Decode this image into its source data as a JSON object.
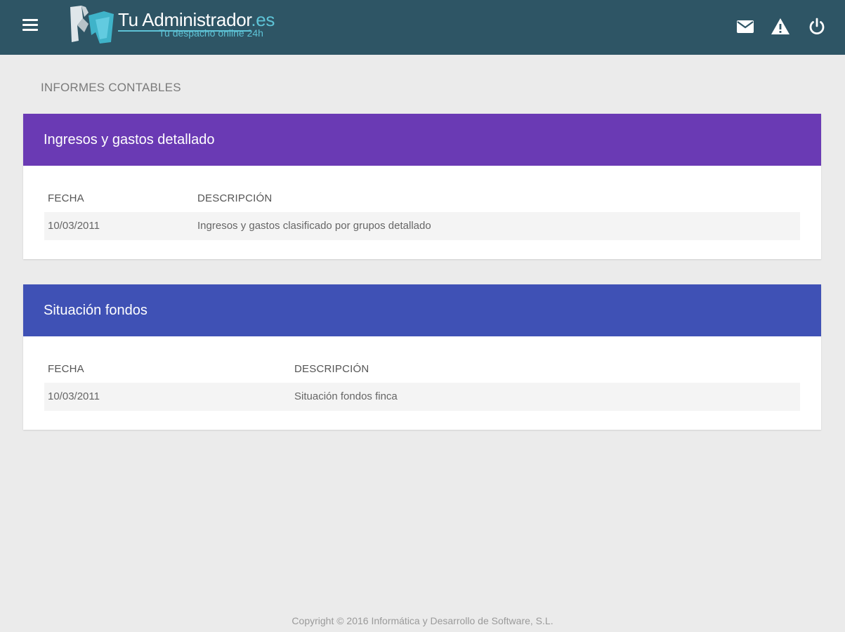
{
  "header": {
    "logo_title_main": "Tu Administrador",
    "logo_title_ext": ".es",
    "logo_subtitle": "Tu despacho online 24h",
    "icons": [
      "menu-icon",
      "mail-icon",
      "warning-icon",
      "power-icon"
    ],
    "background_color": "#2e5565",
    "accent_color": "#5ec3d6"
  },
  "page": {
    "title": "INFORMES CONTABLES"
  },
  "reports": [
    {
      "title": "Ingresos y gastos detallado",
      "header_color": "#6a3ab4",
      "columns": [
        "FECHA",
        "DESCRIPCIÓN"
      ],
      "rows": [
        {
          "fecha": "10/03/2011",
          "descripcion": "Ingresos y gastos clasificado por grupos detallado"
        }
      ]
    },
    {
      "title": "Situación fondos",
      "header_color": "#3f51b5",
      "columns": [
        "FECHA",
        "DESCRIPCIÓN"
      ],
      "rows": [
        {
          "fecha": "10/03/2011",
          "descripcion": "Situación fondos finca"
        }
      ]
    }
  ],
  "footer": {
    "copyright": "Copyright © 2016 Informática y Desarrollo de Software, S.L."
  }
}
